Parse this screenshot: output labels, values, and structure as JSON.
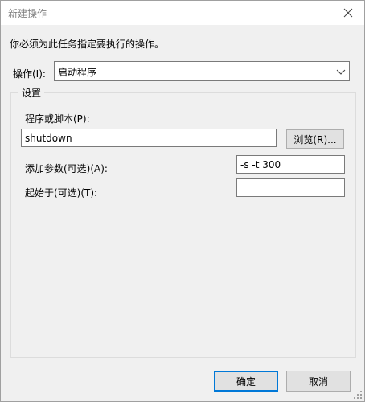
{
  "window": {
    "title": "新建操作"
  },
  "instruction": "你必须为此任务指定要执行的操作。",
  "action": {
    "label": "操作(I):",
    "selected": "启动程序"
  },
  "settings": {
    "legend": "设置",
    "program_label": "程序或脚本(P):",
    "program_value": "shutdown",
    "browse_label": "浏览(R)...",
    "args_label": "添加参数(可选)(A):",
    "args_value": "-s -t 300",
    "start_in_label": "起始于(可选)(T):",
    "start_in_value": ""
  },
  "footer": {
    "ok_label": "确定",
    "cancel_label": "取消"
  },
  "icons": {
    "close": "close-icon",
    "dropdown": "chevron-down-icon",
    "grip": "resize-grip-icon"
  },
  "colors": {
    "accent": "#0078d7",
    "title_text": "#808080"
  }
}
